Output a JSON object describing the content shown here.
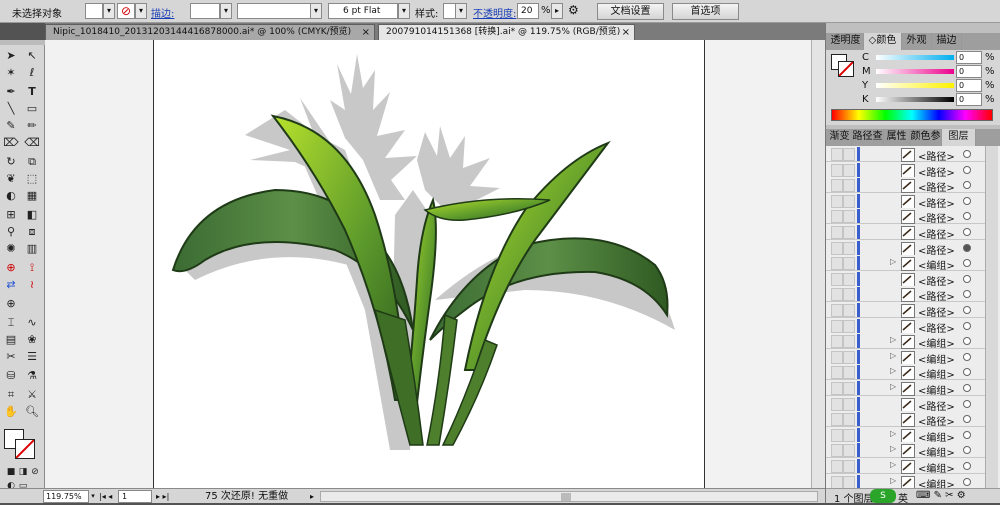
{
  "control": {
    "selection_label": "未选择对象",
    "stroke_label": "描边:",
    "stroke_value": "",
    "brush_value": "6 pt Flat",
    "style_label": "样式:",
    "opacity_label": "不透明度:",
    "opacity_value": "20",
    "opacity_unit": "%",
    "doc_setup": "文档设置",
    "prefs": "首选项"
  },
  "tabs": [
    {
      "label": "Nipic_1018410_20131203144416878000.ai* @ 100% (CMYK/预览)"
    },
    {
      "label": "200791014151368 [转换].ai* @ 119.75% (RGB/预览)"
    }
  ],
  "status": {
    "zoom": "119.75%",
    "page": "1",
    "message": "75 次还原! 无重做"
  },
  "color_panel": {
    "tabs": [
      "透明度",
      "◇颜色",
      "外观",
      "描边"
    ],
    "channels": [
      {
        "label": "C",
        "value": "0",
        "unit": "%"
      },
      {
        "label": "M",
        "value": "0",
        "unit": "%"
      },
      {
        "label": "Y",
        "value": "0",
        "unit": "%"
      },
      {
        "label": "K",
        "value": "0",
        "unit": "%"
      }
    ]
  },
  "layers_panel": {
    "tabs": [
      "渐变",
      "路径查",
      "属性",
      "颜色参",
      "图层"
    ],
    "rows": [
      {
        "name": "<路径>",
        "type": "path",
        "selected": false
      },
      {
        "name": "<路径>",
        "type": "path",
        "selected": false
      },
      {
        "name": "<路径>",
        "type": "path",
        "selected": false
      },
      {
        "name": "<路径>",
        "type": "path",
        "selected": false
      },
      {
        "name": "<路径>",
        "type": "path",
        "selected": false
      },
      {
        "name": "<路径>",
        "type": "path",
        "selected": false
      },
      {
        "name": "<路径>",
        "type": "path",
        "selected": true
      },
      {
        "name": "<编组>",
        "type": "group",
        "selected": false
      },
      {
        "name": "<路径>",
        "type": "path",
        "selected": false
      },
      {
        "name": "<路径>",
        "type": "path",
        "selected": false
      },
      {
        "name": "<路径>",
        "type": "path",
        "selected": false
      },
      {
        "name": "<路径>",
        "type": "path",
        "selected": false
      },
      {
        "name": "<编组>",
        "type": "group",
        "selected": false
      },
      {
        "name": "<编组>",
        "type": "group",
        "selected": false
      },
      {
        "name": "<编组>",
        "type": "group",
        "selected": false
      },
      {
        "name": "<编组>",
        "type": "group",
        "selected": false
      },
      {
        "name": "<路径>",
        "type": "path",
        "selected": false
      },
      {
        "name": "<路径>",
        "type": "path",
        "selected": false
      },
      {
        "name": "<编组>",
        "type": "group",
        "selected": false
      },
      {
        "name": "<编组>",
        "type": "group",
        "selected": false
      },
      {
        "name": "<编组>",
        "type": "group",
        "selected": false
      },
      {
        "name": "<编组>",
        "type": "group",
        "selected": false
      }
    ],
    "footer": "1 个图层",
    "ime": "英"
  },
  "colors": {
    "accent_blue": "#3a5fcd",
    "leaf_dark": "#2f5a22",
    "leaf_mid": "#4f8a2e",
    "leaf_light": "#9bd32c",
    "shadow_gray": "#c8c8c8"
  }
}
